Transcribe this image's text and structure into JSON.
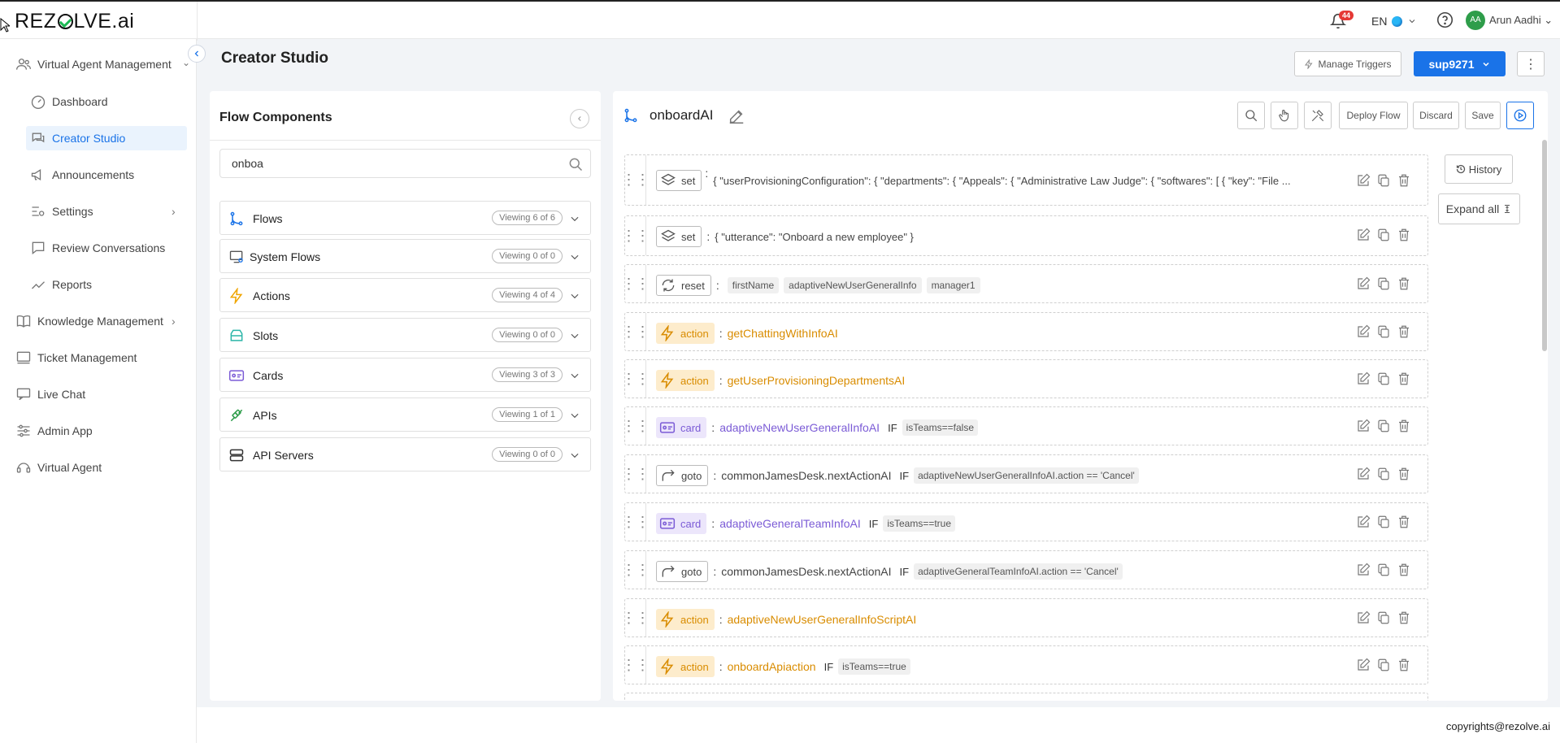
{
  "header": {
    "logo": "REZOLVE.ai",
    "notification_count": "44",
    "language": "EN",
    "user_initials": "AA",
    "user_name": "Arun Aadhi"
  },
  "sidebar": {
    "items": [
      {
        "label": "Virtual Agent Management",
        "icon": "users-icon"
      },
      {
        "label": "Dashboard",
        "icon": "gauge-icon"
      },
      {
        "label": "Creator Studio",
        "icon": "chat-icon",
        "active": true
      },
      {
        "label": "Announcements",
        "icon": "megaphone-icon"
      },
      {
        "label": "Settings",
        "icon": "settings-icon"
      },
      {
        "label": "Review Conversations",
        "icon": "review-icon"
      },
      {
        "label": "Reports",
        "icon": "trend-icon"
      },
      {
        "label": "Knowledge Management",
        "icon": "book-icon"
      },
      {
        "label": "Ticket Management",
        "icon": "ticket-icon"
      },
      {
        "label": "Live Chat",
        "icon": "livechat-icon"
      },
      {
        "label": "Admin App",
        "icon": "sliders-icon"
      },
      {
        "label": "Virtual Agent",
        "icon": "agent-icon"
      }
    ]
  },
  "page": {
    "title": "Creator Studio",
    "manage_triggers": "Manage Triggers",
    "tenant": "sup9271"
  },
  "components": {
    "title": "Flow Components",
    "search_value": "onboa",
    "sections": [
      {
        "label": "Flows",
        "badge": "Viewing 6 of 6"
      },
      {
        "label": "System Flows",
        "badge": "Viewing 0 of 0"
      },
      {
        "label": "Actions",
        "badge": "Viewing 4 of 4"
      },
      {
        "label": "Slots",
        "badge": "Viewing 0 of 0"
      },
      {
        "label": "Cards",
        "badge": "Viewing 3 of 3"
      },
      {
        "label": "APIs",
        "badge": "Viewing 1 of 1"
      },
      {
        "label": "API Servers",
        "badge": "Viewing 0 of 0"
      }
    ]
  },
  "flow": {
    "name": "onboardAI",
    "toolbar": {
      "deploy": "Deploy Flow",
      "discard": "Discard",
      "save": "Save"
    },
    "history": "History",
    "expand_all": "Expand all",
    "steps": [
      {
        "type": "set",
        "sep": ":",
        "text": "{ \"userProvisioningConfiguration\": { \"departments\": { \"Appeals\": { \"Administrative Law Judge\": { \"softwares\": [ { \"key\": \"File ..."
      },
      {
        "type": "set",
        "sep": ":",
        "text": "{ \"utterance\": \"Onboard a new employee\" }"
      },
      {
        "type": "reset",
        "sep": ":",
        "tags": [
          "firstName",
          "adaptiveNewUserGeneralInfo",
          "manager1"
        ]
      },
      {
        "type": "action",
        "sep": ":",
        "name": "getChattingWithInfoAI"
      },
      {
        "type": "action",
        "sep": ":",
        "name": "getUserProvisioningDepartmentsAI"
      },
      {
        "type": "card",
        "sep": ":",
        "name": "adaptiveNewUserGeneralInfoAI",
        "if": "IF",
        "cond": "isTeams==false"
      },
      {
        "type": "goto",
        "sep": ":",
        "name": "commonJamesDesk.nextActionAI",
        "if": "IF",
        "cond": "adaptiveNewUserGeneralInfoAI.action == 'Cancel'"
      },
      {
        "type": "card",
        "sep": ":",
        "name": "adaptiveGeneralTeamInfoAI",
        "if": "IF",
        "cond": "isTeams==true"
      },
      {
        "type": "goto",
        "sep": ":",
        "name": "commonJamesDesk.nextActionAI",
        "if": "IF",
        "cond": "adaptiveGeneralTeamInfoAI.action == 'Cancel'"
      },
      {
        "type": "action",
        "sep": ":",
        "name": "adaptiveNewUserGeneralInfoScriptAI"
      },
      {
        "type": "action",
        "sep": ":",
        "name": "onboardApiaction",
        "if": "IF",
        "cond": "isTeams==true"
      }
    ]
  },
  "footer": {
    "copyright": "copyrights@rezolve.ai"
  },
  "colors": {
    "primary": "#1a73e8",
    "action": "#d98c00",
    "card": "#7b5bd6",
    "success": "#2e9d4a",
    "danger": "#e53935"
  }
}
